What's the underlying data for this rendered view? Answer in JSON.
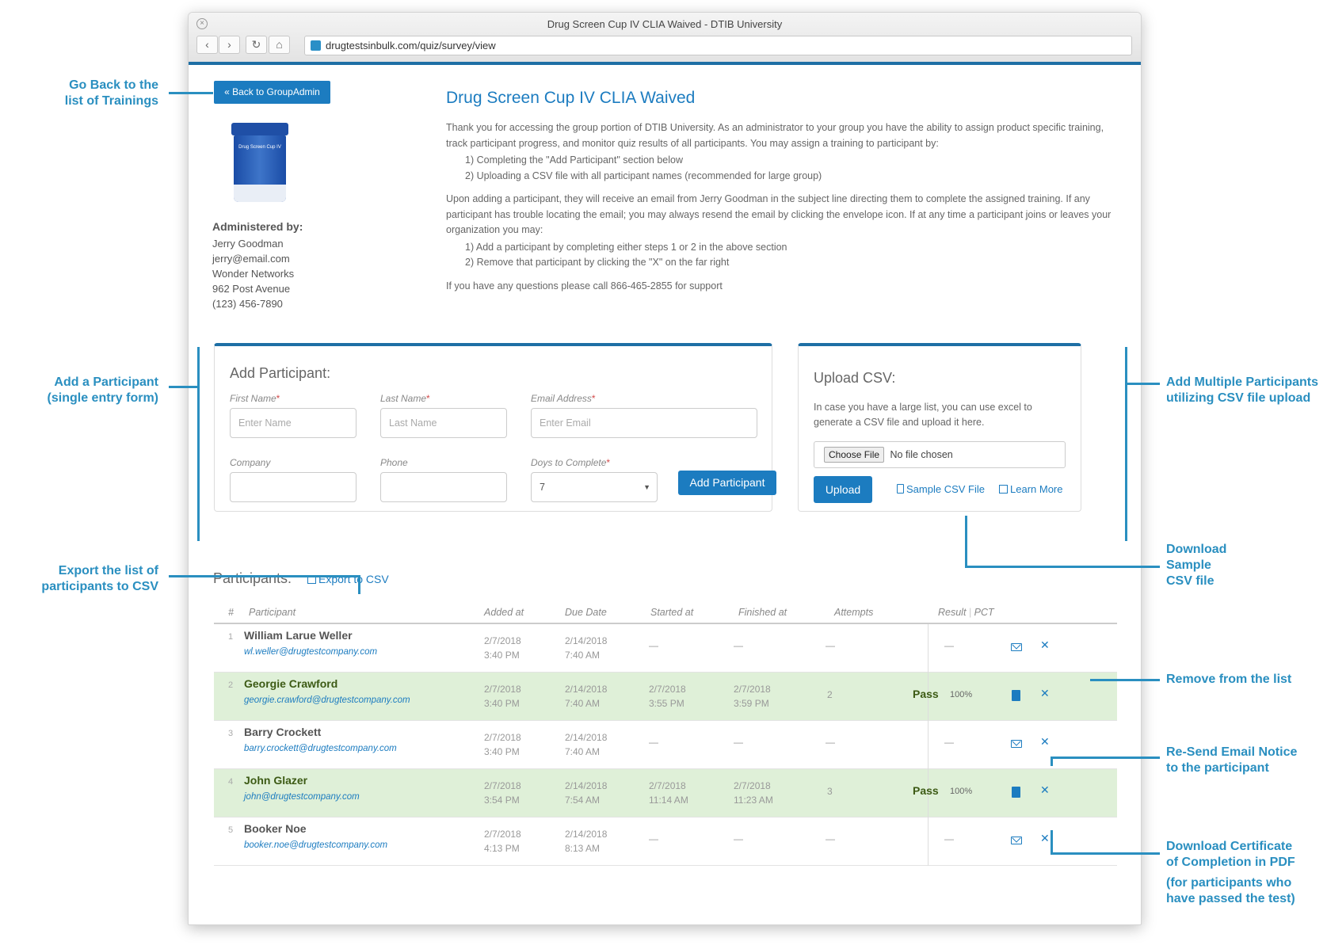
{
  "browser": {
    "window_title": "Drug Screen Cup IV CLIA Waived - DTIB University",
    "url": "drugtestsinbulk.com/quiz/survey/view"
  },
  "sidebar": {
    "back_button": "« Back to GroupAdmin",
    "product_label": "Drug Screen Cup IV",
    "admin_title": "Administered by:",
    "admin_lines": [
      "Jerry Goodman",
      "jerry@email.com",
      "Wonder Networks",
      "962 Post Avenue",
      "(123) 456-7890"
    ]
  },
  "main": {
    "title": "Drug Screen Cup IV CLIA Waived",
    "intro_p1": "Thank you for accessing the group portion of DTIB University. As an administrator to your group you have the ability to assign product specific training, track participant progress, and monitor quiz results of all participants.  You may assign a training to participant by:",
    "intro_steps1": [
      "1) Completing the \"Add Participant\" section below",
      "2) Uploading a CSV file with all participant names (recommended for large group)"
    ],
    "intro_p2": "Upon adding a participant, they will receive an email from Jerry Goodman in the subject line directing them to complete the assigned training.  If any participant has trouble locating the email; you may always resend the email by clicking the envelope icon.  If at any time a participant joins or leaves your organization you may:",
    "intro_steps2": [
      "1) Add a participant by completing either steps 1 or 2 in the above section",
      "2) Remove that participant by clicking the \"X\" on the far right"
    ],
    "intro_p3": "If you have any questions please call 866-465-2855 for support"
  },
  "add_participant": {
    "title": "Add Participant:",
    "first_name_label": "First Name",
    "first_name_placeholder": "Enter Name",
    "last_name_label": "Last Name",
    "last_name_placeholder": "Last Name",
    "email_label": "Email Address",
    "email_placeholder": "Enter Email",
    "company_label": "Company",
    "phone_label": "Phone",
    "days_label": "Doys to Complete",
    "days_value": "7",
    "required_mark": "*",
    "submit": "Add Participant"
  },
  "upload_csv": {
    "title": "Upload CSV:",
    "description": "In case you have a large list, you can use excel to generate a CSV file and upload it here.",
    "choose_file": "Choose File",
    "no_file": "No file chosen",
    "upload_button": "Upload",
    "sample_link": "Sample CSV File",
    "learn_more": "Learn More"
  },
  "participants": {
    "title": "Participants:",
    "export_link": "Export to CSV",
    "columns": [
      "#",
      "Participant",
      "Added at",
      "Due Date",
      "Started at",
      "Finished at",
      "Attempts",
      "Result",
      "PCT"
    ],
    "col_separator": "|",
    "rows": [
      {
        "num": "1",
        "name": "William Larue Weller",
        "email": "wl.weller@drugtestcompany.com",
        "added_date": "2/7/2018",
        "added_time": "3:40 PM",
        "due_date": "2/14/2018",
        "due_time": "7:40 AM",
        "started": "—",
        "finished": "—",
        "attempts": "—",
        "result": "—"
      },
      {
        "num": "2",
        "name": "Georgie Crawford",
        "email": "georgie.crawford@drugtestcompany.com",
        "added_date": "2/7/2018",
        "added_time": "3:40 PM",
        "due_date": "2/14/2018",
        "due_time": "7:40 AM",
        "started_date": "2/7/2018",
        "started_time": "3:55 PM",
        "finished_date": "2/7/2018",
        "finished_time": "3:59 PM",
        "attempts": "2",
        "result": "Pass",
        "pct": "100%"
      },
      {
        "num": "3",
        "name": "Barry Crockett",
        "email": "barry.crockett@drugtestcompany.com",
        "added_date": "2/7/2018",
        "added_time": "3:40 PM",
        "due_date": "2/14/2018",
        "due_time": "7:40 AM",
        "started": "—",
        "finished": "—",
        "attempts": "—",
        "result": "—"
      },
      {
        "num": "4",
        "name": "John Glazer",
        "email": "john@drugtestcompany.com",
        "added_date": "2/7/2018",
        "added_time": "3:54 PM",
        "due_date": "2/14/2018",
        "due_time": "7:54 AM",
        "started_date": "2/7/2018",
        "started_time": "11:14 AM",
        "finished_date": "2/7/2018",
        "finished_time": "11:23 AM",
        "attempts": "3",
        "result": "Pass",
        "pct": "100%"
      },
      {
        "num": "5",
        "name": "Booker Noe",
        "email": "booker.noe@drugtestcompany.com",
        "added_date": "2/7/2018",
        "added_time": "4:13 PM",
        "due_date": "2/14/2018",
        "due_time": "8:13 AM",
        "started": "—",
        "finished": "—",
        "attempts": "—",
        "result": "—"
      }
    ]
  },
  "annotations": {
    "go_back": [
      "Go Back to the",
      "list of Trainings"
    ],
    "add_single": [
      "Add a Participant",
      "(single entry form)"
    ],
    "export": [
      "Export the list of",
      "participants to CSV"
    ],
    "add_multiple": [
      "Add Multiple Participants",
      "utilizing CSV file upload"
    ],
    "download_sample": [
      "Download",
      "Sample",
      "CSV file"
    ],
    "remove": [
      "Remove from the list"
    ],
    "resend": [
      "Re-Send Email Notice",
      "to the participant"
    ],
    "certificate": [
      "Download Certificate",
      "of Completion in PDF"
    ],
    "certificate_note": [
      "(for participants who",
      "have passed the test)"
    ]
  },
  "colors": {
    "accent": "#1c7cc0",
    "annotation": "#2a8fc0",
    "pass_row": "#dff0d8",
    "window_border": "#1e6fa5"
  }
}
